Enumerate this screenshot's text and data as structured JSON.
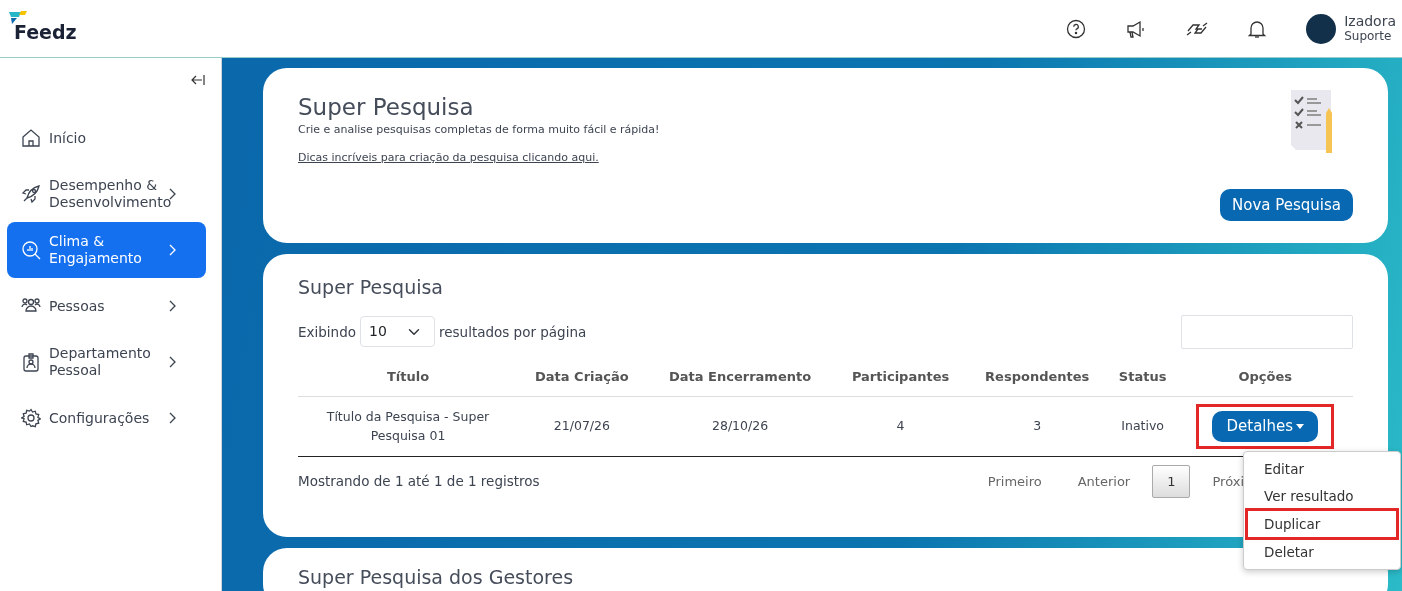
{
  "brand": "Feedz",
  "header": {
    "user_name": "Izadora",
    "user_role": "Suporte"
  },
  "sidebar": {
    "items": [
      {
        "label": "Início",
        "has_submenu": false,
        "selected": false
      },
      {
        "label": "Desempenho & Desenvolvimento",
        "has_submenu": true,
        "selected": false
      },
      {
        "label": "Clima & Engajamento",
        "has_submenu": true,
        "selected": true
      },
      {
        "label": "Pessoas",
        "has_submenu": true,
        "selected": false
      },
      {
        "label": "Departamento Pessoal",
        "has_submenu": true,
        "selected": false
      },
      {
        "label": "Configurações",
        "has_submenu": true,
        "selected": false
      }
    ]
  },
  "intro_card": {
    "title": "Super Pesquisa",
    "subtitle": "Crie e analise pesquisas completas de forma muito fácil e rápida!",
    "link": "Dicas incríveis para criação da pesquisa clicando aqui.",
    "button": "Nova Pesquisa"
  },
  "survey_card": {
    "title": "Super Pesquisa",
    "length_prefix": "Exibindo",
    "length_value": "10",
    "length_suffix": "resultados por página",
    "table": {
      "columns": [
        "Título",
        "Data Criação",
        "Data Encerramento",
        "Participantes",
        "Respondentes",
        "Status",
        "Opções"
      ],
      "rows": [
        {
          "cells": [
            "Título da Pesquisa - Super Pesquisa 01",
            "21/07/26",
            "28/10/26",
            "4",
            "3",
            "Inativo"
          ],
          "action": "Detalhes",
          "highlighted": true
        }
      ]
    },
    "info": "Mostrando de 1 até 1 de 1 registros",
    "pagination": [
      {
        "label": "Primeiro",
        "selected": false
      },
      {
        "label": "Anterior",
        "selected": false
      },
      {
        "label": "1",
        "selected": true
      },
      {
        "label": "Próxi",
        "selected": false
      }
    ],
    "menu": [
      {
        "label": "Editar",
        "highlighted": false
      },
      {
        "label": "Ver resultado",
        "highlighted": false
      },
      {
        "label": "Duplicar",
        "highlighted": true
      },
      {
        "label": "Deletar",
        "highlighted": false
      }
    ]
  },
  "next_card": {
    "title": "Super Pesquisa dos Gestores"
  }
}
